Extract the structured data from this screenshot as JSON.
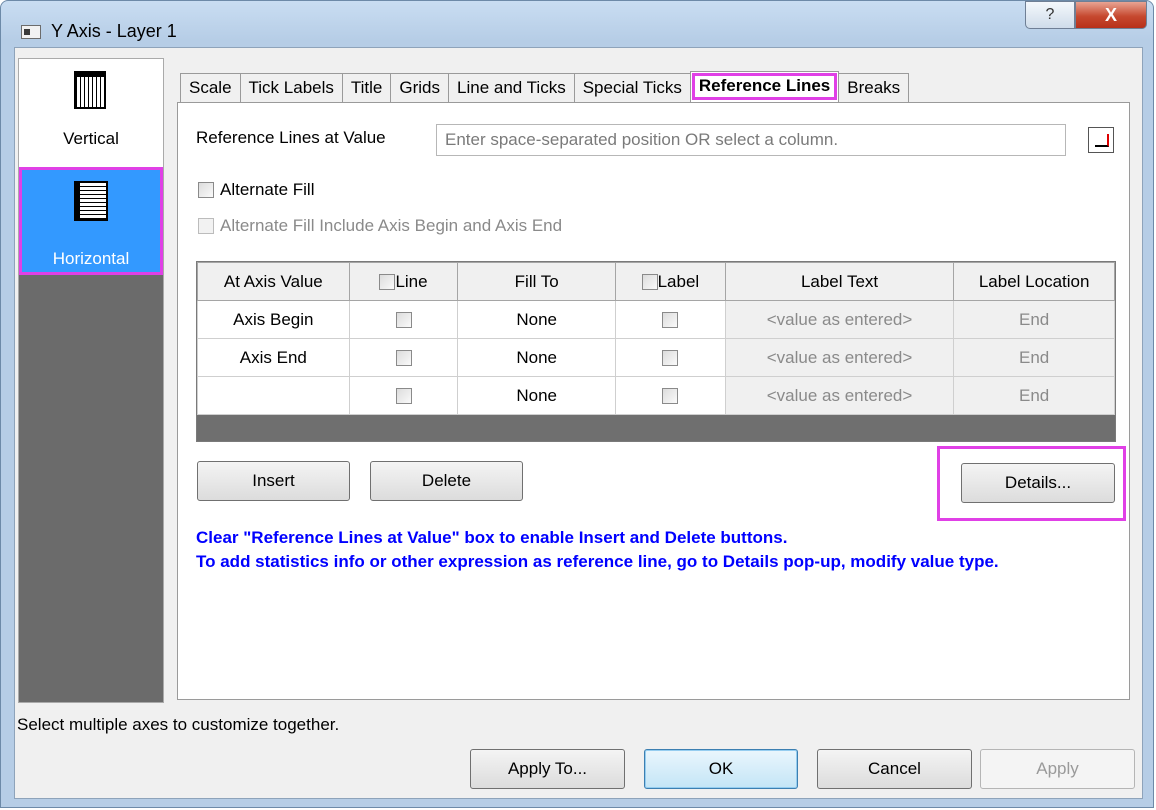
{
  "window": {
    "title": "Y Axis - Layer 1",
    "help_glyph": "?",
    "close_glyph": "X"
  },
  "sidebar": {
    "items": [
      {
        "label": "Vertical"
      },
      {
        "label": "Horizontal"
      }
    ],
    "selected": "Horizontal"
  },
  "tabs": [
    "Scale",
    "Tick Labels",
    "Title",
    "Grids",
    "Line and Ticks",
    "Special Ticks",
    "Reference Lines",
    "Breaks"
  ],
  "active_tab": "Reference Lines",
  "ref": {
    "label": "Reference Lines at Value",
    "placeholder": "Enter space-separated position OR select a column.",
    "alternate_fill": "Alternate Fill",
    "alternate_fill_axis": "Alternate Fill Include Axis Begin and Axis End"
  },
  "grid": {
    "headers": [
      "At Axis Value",
      "Line",
      "Fill To",
      "Label",
      "Label Text",
      "Label Location"
    ],
    "rows": [
      {
        "at": "Axis Begin",
        "fill": "None",
        "text": "<value as entered>",
        "loc": "End"
      },
      {
        "at": "Axis End",
        "fill": "None",
        "text": "<value as entered>",
        "loc": "End"
      },
      {
        "at": "",
        "fill": "None",
        "text": "<value as entered>",
        "loc": "End"
      }
    ]
  },
  "buttons": {
    "insert": "Insert",
    "delete": "Delete",
    "details": "Details...",
    "apply_to": "Apply To...",
    "ok": "OK",
    "cancel": "Cancel",
    "apply": "Apply"
  },
  "notes": [
    "Clear \"Reference Lines at Value\" box to enable Insert and Delete buttons.",
    "To add statistics info or other expression as reference line, go to Details pop-up, modify value type."
  ],
  "status": "Select multiple axes to customize together.",
  "colors": {
    "highlight": "#e040e6",
    "selected": "#3399ff",
    "note": "#0000ff"
  }
}
